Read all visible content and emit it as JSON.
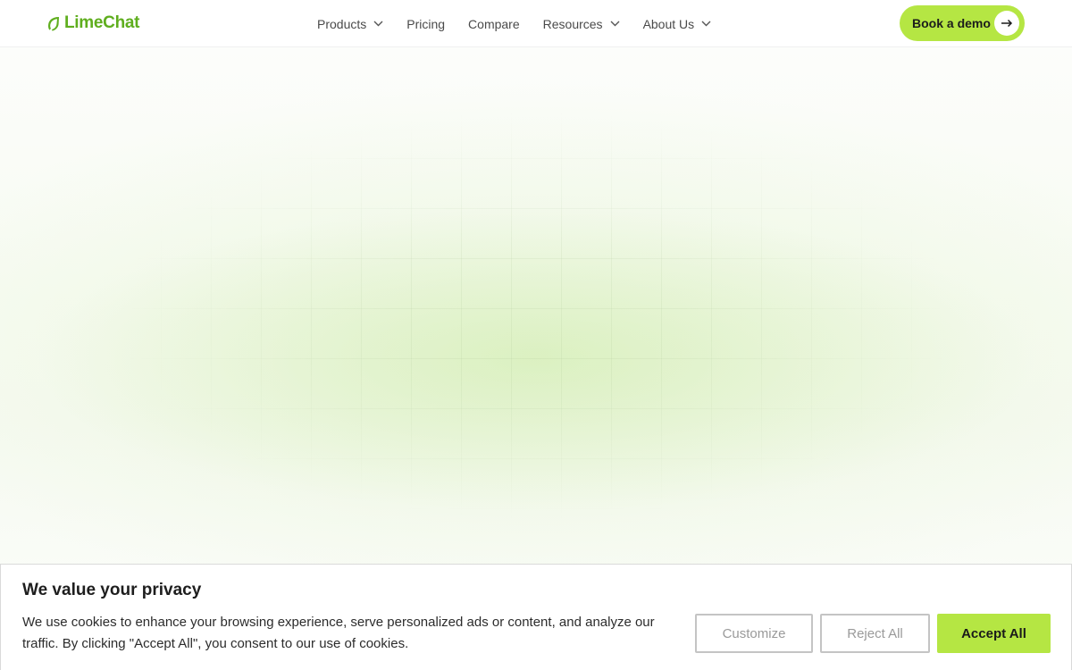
{
  "brand": {
    "name": "LimeChat",
    "color": "#5fae1e",
    "icon": "leaf-icon"
  },
  "nav": {
    "items": [
      {
        "label": "Products",
        "has_dropdown": true
      },
      {
        "label": "Pricing",
        "has_dropdown": false
      },
      {
        "label": "Compare",
        "has_dropdown": false
      },
      {
        "label": "Resources",
        "has_dropdown": true
      },
      {
        "label": "About Us",
        "has_dropdown": true
      }
    ]
  },
  "cta": {
    "label": "Book a demo",
    "icon": "arrow-right-icon",
    "color": "#b5e643"
  },
  "cookie_banner": {
    "title": "We value your privacy",
    "text": "We use cookies to enhance your browsing experience, serve personalized ads or content, and analyze our traffic. By clicking \"Accept All\", you consent to our use of cookies.",
    "customize_label": "Customize",
    "reject_label": "Reject All",
    "accept_label": "Accept All"
  }
}
